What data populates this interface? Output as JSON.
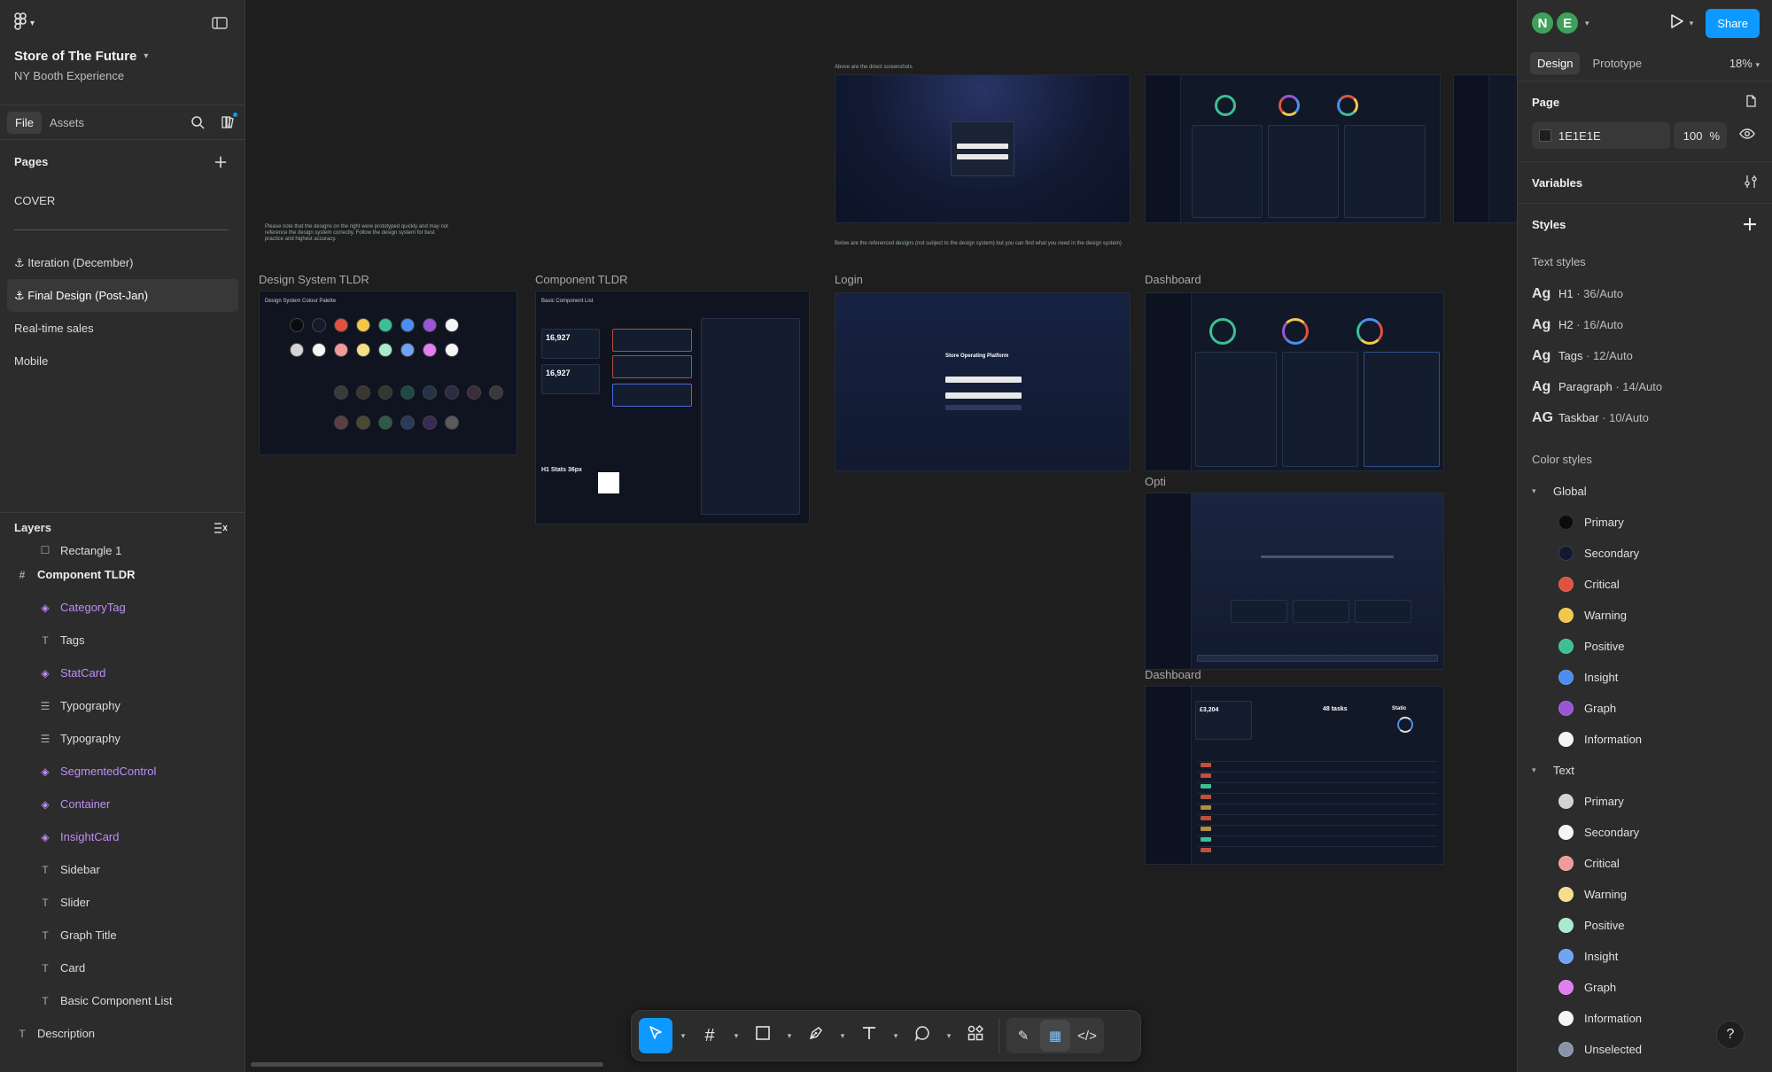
{
  "project": {
    "title": "Store of The Future",
    "subtitle": "NY Booth Experience"
  },
  "left_tabs": [
    "File",
    "Assets"
  ],
  "pages": {
    "heading": "Pages",
    "items": [
      "COVER",
      "⚓ Iteration (December)",
      "⚓ Final Design (Post-Jan)",
      "Real-time sales",
      "Mobile"
    ],
    "active_index": 2
  },
  "layers": {
    "heading": "Layers",
    "items": [
      {
        "label": "Rectangle 1",
        "kind": "rect",
        "indent": 1
      },
      {
        "label": "Component TLDR",
        "kind": "frame",
        "indent": 0
      },
      {
        "label": "CategoryTag",
        "kind": "component",
        "indent": 1
      },
      {
        "label": "Tags",
        "kind": "text",
        "indent": 1
      },
      {
        "label": "StatCard",
        "kind": "component",
        "indent": 1
      },
      {
        "label": "Typography",
        "kind": "group",
        "indent": 1
      },
      {
        "label": "Typography",
        "kind": "group",
        "indent": 1
      },
      {
        "label": "SegmentedControl",
        "kind": "component",
        "indent": 1
      },
      {
        "label": "Container",
        "kind": "component",
        "indent": 1
      },
      {
        "label": "InsightCard",
        "kind": "component",
        "indent": 1
      },
      {
        "label": "Sidebar",
        "kind": "text",
        "indent": 1
      },
      {
        "label": "Slider",
        "kind": "text",
        "indent": 1
      },
      {
        "label": "Graph Title",
        "kind": "text",
        "indent": 1
      },
      {
        "label": "Card",
        "kind": "text",
        "indent": 1
      },
      {
        "label": "Basic Component List",
        "kind": "text",
        "indent": 1
      },
      {
        "label": "Description",
        "kind": "text",
        "indent": 0
      }
    ]
  },
  "canvas": {
    "frames": [
      {
        "name": "design-system",
        "label": "Design System TLDR"
      },
      {
        "name": "component",
        "label": "Component TLDR"
      },
      {
        "name": "login",
        "label": "Login"
      },
      {
        "name": "dashboard-1",
        "label": "Dashboard"
      },
      {
        "name": "opti",
        "label": "Opti"
      },
      {
        "name": "dashboard-2",
        "label": "Dashboard"
      }
    ],
    "note_left": "Please note that the designs on the right were prototyped quickly and may not reference the design system correctly. Follow the design system for best practice and highest accuracy.",
    "note_top": "Above are the direct screenshots",
    "note_bottom": "Below are the referenced designs (not subject to the design system) but you can find what you need in the design system)",
    "ds_title": "Design System Colour Palette",
    "cl_title": "Basic Component List",
    "stat_value": "16,927",
    "stat_value_2": "16,927",
    "h1_label": "H1 Stats 36px",
    "login_title": "Store Operating Platform",
    "dash2_value": "£3,204",
    "dash2_tasks": "48 tasks",
    "dash2_static": "Static"
  },
  "right_panel": {
    "avatars": [
      "N",
      "E"
    ],
    "share_label": "Share",
    "tabs": [
      "Design",
      "Prototype"
    ],
    "zoom": "18%",
    "page": {
      "heading": "Page",
      "color": "1E1E1E",
      "opacity": "100",
      "opacity_unit": "%"
    },
    "variables_heading": "Variables",
    "styles_heading": "Styles",
    "text_styles_heading": "Text styles",
    "text_styles": [
      {
        "ag": "Ag",
        "name": "H1",
        "meta": " · 36/Auto"
      },
      {
        "ag": "Ag",
        "name": "H2",
        "meta": " · 16/Auto"
      },
      {
        "ag": "Ag",
        "name": "Tags",
        "meta": " · 12/Auto"
      },
      {
        "ag": "Ag",
        "name": "Paragraph",
        "meta": " · 14/Auto"
      },
      {
        "ag": "AG",
        "name": "Taskbar",
        "meta": " · 10/Auto"
      }
    ],
    "color_styles_heading": "Color styles",
    "global_group": "Global",
    "global_colors": [
      {
        "name": "Primary",
        "color": "#0b0b0f"
      },
      {
        "name": "Secondary",
        "color": "#141a2e"
      },
      {
        "name": "Critical",
        "color": "#e0523f"
      },
      {
        "name": "Warning",
        "color": "#f2c84b"
      },
      {
        "name": "Positive",
        "color": "#3cbf95"
      },
      {
        "name": "Insight",
        "color": "#4a8ef0"
      },
      {
        "name": "Graph",
        "color": "#9a55d6"
      },
      {
        "name": "Information",
        "color": "#f5f5f5"
      }
    ],
    "text_group": "Text",
    "text_colors": [
      {
        "name": "Primary",
        "color": "#d4d4d4"
      },
      {
        "name": "Secondary",
        "color": "#f5f5f5"
      },
      {
        "name": "Critical",
        "color": "#f29a9a"
      },
      {
        "name": "Warning",
        "color": "#f5de8a"
      },
      {
        "name": "Positive",
        "color": "#a8ebcc"
      },
      {
        "name": "Insight",
        "color": "#6fa3f5"
      },
      {
        "name": "Graph",
        "color": "#e07ef2"
      },
      {
        "name": "Information",
        "color": "#f5f5f5"
      },
      {
        "name": "Unselected",
        "color": "#8a94a8"
      }
    ]
  }
}
